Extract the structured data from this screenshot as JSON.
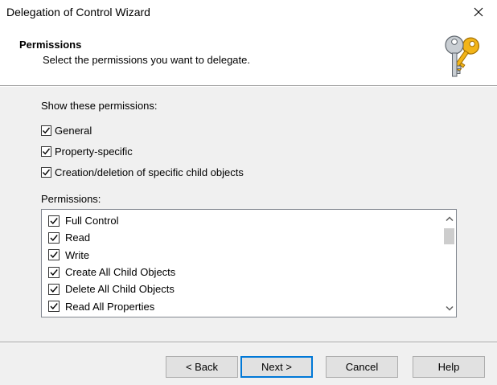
{
  "window": {
    "title": "Delegation of Control Wizard"
  },
  "header": {
    "title": "Permissions",
    "subtitle": "Select the permissions you want to delegate."
  },
  "show_section": {
    "label": "Show these permissions:",
    "options": [
      {
        "label": "General",
        "checked": true
      },
      {
        "label": "Property-specific",
        "checked": true
      },
      {
        "label": "Creation/deletion of specific child objects",
        "checked": true
      }
    ]
  },
  "permissions": {
    "label": "Permissions:",
    "items": [
      {
        "label": "Full Control",
        "checked": true
      },
      {
        "label": "Read",
        "checked": true
      },
      {
        "label": "Write",
        "checked": true
      },
      {
        "label": "Create All Child Objects",
        "checked": true
      },
      {
        "label": "Delete All Child Objects",
        "checked": true
      },
      {
        "label": "Read All Properties",
        "checked": true
      }
    ]
  },
  "buttons": {
    "back": "< Back",
    "next": "Next >",
    "cancel": "Cancel",
    "help": "Help"
  },
  "colors": {
    "accent": "#0078d7",
    "background": "#f0f0f0",
    "header_bg": "#ffffff"
  },
  "icons": {
    "close": "close-icon",
    "header": "keys-icon",
    "checkbox": "checkmark-icon",
    "scroll_up": "chevron-up-icon",
    "scroll_down": "chevron-down-icon"
  }
}
